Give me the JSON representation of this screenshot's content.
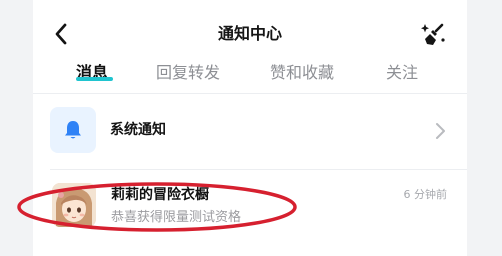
{
  "header": {
    "title": "通知中心",
    "back_icon": "chevron-left-icon",
    "clean_icon": "broom-sparkle-icon"
  },
  "tabs": [
    {
      "label": "消息",
      "active": true
    },
    {
      "label": "回复转发",
      "active": false
    },
    {
      "label": "赞和收藏",
      "active": false
    },
    {
      "label": "关注",
      "active": false
    }
  ],
  "colors": {
    "accent": "#20c4cf",
    "annotation": "#d6202f",
    "system_icon": "#2f82f6"
  },
  "system_notice": {
    "label": "系统通知",
    "icon": "bell-icon"
  },
  "messages": [
    {
      "title": "莉莉的冒险衣橱",
      "subtitle": "恭喜获得限量测试资格",
      "time": "6 分钟前",
      "avatar": "cartoon-girl-avatar"
    }
  ]
}
